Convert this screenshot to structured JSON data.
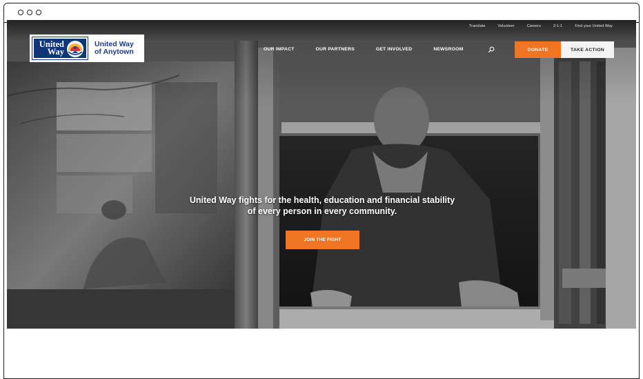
{
  "window": {
    "controls": [
      "close",
      "minimize",
      "maximize"
    ]
  },
  "utility_nav": [
    "Translate",
    "Volunteer",
    "Careers",
    "2-1-1",
    "Find your United Way"
  ],
  "logo": {
    "mark_line1": "United",
    "mark_line2": "Way",
    "name_line1": "United Way",
    "name_line2": "of Anytown",
    "brand_color": "#10367a",
    "emblem_colors": [
      "#f7b33d",
      "#e3322b",
      "#1b3a8a"
    ]
  },
  "main_nav": [
    "OUR IMPACT",
    "OUR PARTNERS",
    "GET INVOLVED",
    "NEWSROOM"
  ],
  "search": {
    "icon": "search-icon"
  },
  "buttons": {
    "donate": "DONATE",
    "take_action": "TAKE ACTION",
    "join": "JOIN THE FIGHT"
  },
  "hero": {
    "headline": "United Way fights for the health, education and financial stability of every person in every community.",
    "image_description_colors": [
      "#2a2a2a",
      "#6e6e6e",
      "#b5b5b5"
    ]
  },
  "colors": {
    "accent": "#f07421",
    "action_bg": "#f4f4f4",
    "nav_text": "#ffffff"
  }
}
